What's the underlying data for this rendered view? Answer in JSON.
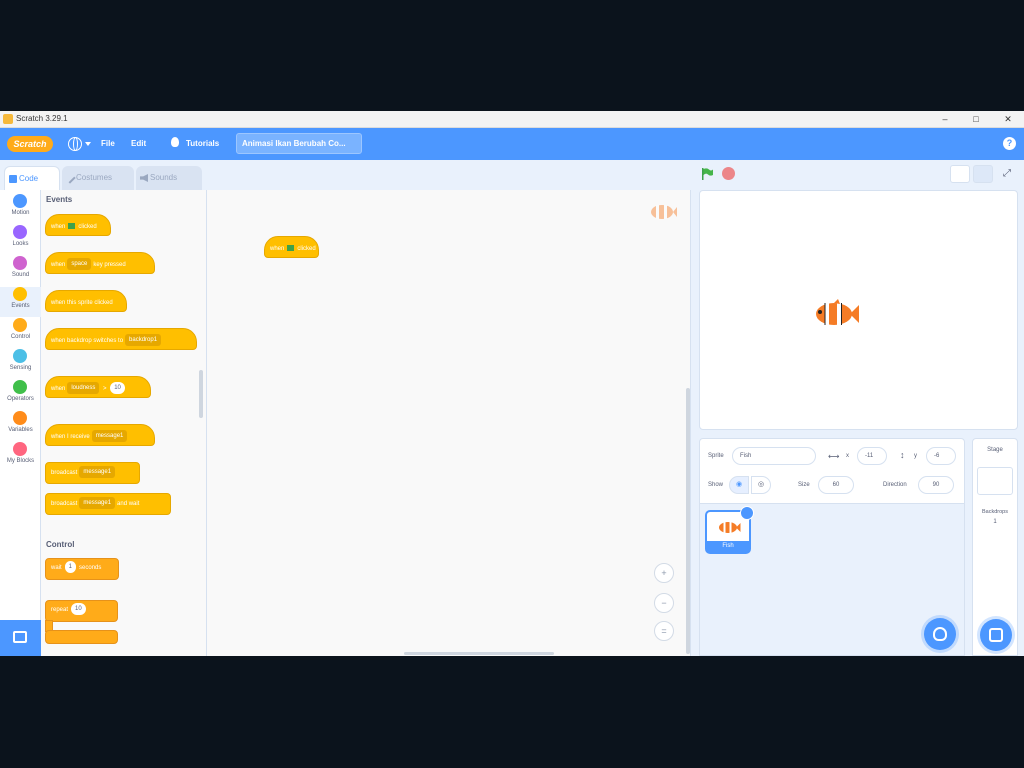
{
  "window": {
    "title": "Scratch 3.29.1",
    "minimize": "–",
    "maximize": "□",
    "close": "✕"
  },
  "menu": {
    "logo": "Scratch",
    "file": "File",
    "edit": "Edit",
    "tutorials": "Tutorials",
    "project_title": "Animasi Ikan Berubah Co...",
    "help": "?"
  },
  "tabs": [
    {
      "label": "Code"
    },
    {
      "label": "Costumes"
    },
    {
      "label": "Sounds"
    }
  ],
  "categories": [
    {
      "label": "Motion",
      "color": "#4c97ff"
    },
    {
      "label": "Looks",
      "color": "#9966ff"
    },
    {
      "label": "Sound",
      "color": "#cf63cf"
    },
    {
      "label": "Events",
      "color": "#ffbf00"
    },
    {
      "label": "Control",
      "color": "#ffab19"
    },
    {
      "label": "Sensing",
      "color": "#4cbfe6"
    },
    {
      "label": "Operators",
      "color": "#40bf4a"
    },
    {
      "label": "Variables",
      "color": "#ff8c1a"
    },
    {
      "label": "My Blocks",
      "color": "#ff6680"
    }
  ],
  "palette": {
    "events_title": "Events",
    "control_title": "Control",
    "events_blocks": [
      {
        "text": "when",
        "suffix": "clicked"
      },
      {
        "text": "when",
        "key": "space",
        "suffix": "key pressed"
      },
      {
        "text": "when this sprite clicked"
      },
      {
        "text": "when backdrop switches to",
        "drop": "backdrop1"
      },
      {
        "text": "when",
        "drop": "loudness",
        "value": "10"
      },
      {
        "text": "when I receive",
        "drop": "message1"
      },
      {
        "text": "broadcast",
        "drop": "message1"
      },
      {
        "text": "broadcast",
        "drop": "message1",
        "suffix": "and wait"
      }
    ],
    "control_blocks": [
      {
        "text": "wait",
        "value": "1",
        "suffix": "seconds"
      },
      {
        "text": "repeat",
        "value": "10"
      }
    ]
  },
  "script": {
    "text": "when",
    "suffix": "clicked"
  },
  "zoom": {
    "in": "+",
    "out": "−",
    "reset": "="
  },
  "sprite_info": {
    "sprite_label": "Sprite",
    "sprite_name": "Fish",
    "x_label": "x",
    "x_value": "-11",
    "y_label": "y",
    "y_value": "-6",
    "show_label": "Show",
    "size_label": "Size",
    "size_value": "60",
    "direction_label": "Direction",
    "direction_value": "90"
  },
  "sprites": [
    {
      "name": "Fish"
    }
  ],
  "stage_panel": {
    "title": "Stage",
    "backdrops_label": "Backdrops",
    "backdrops_count": "1"
  }
}
